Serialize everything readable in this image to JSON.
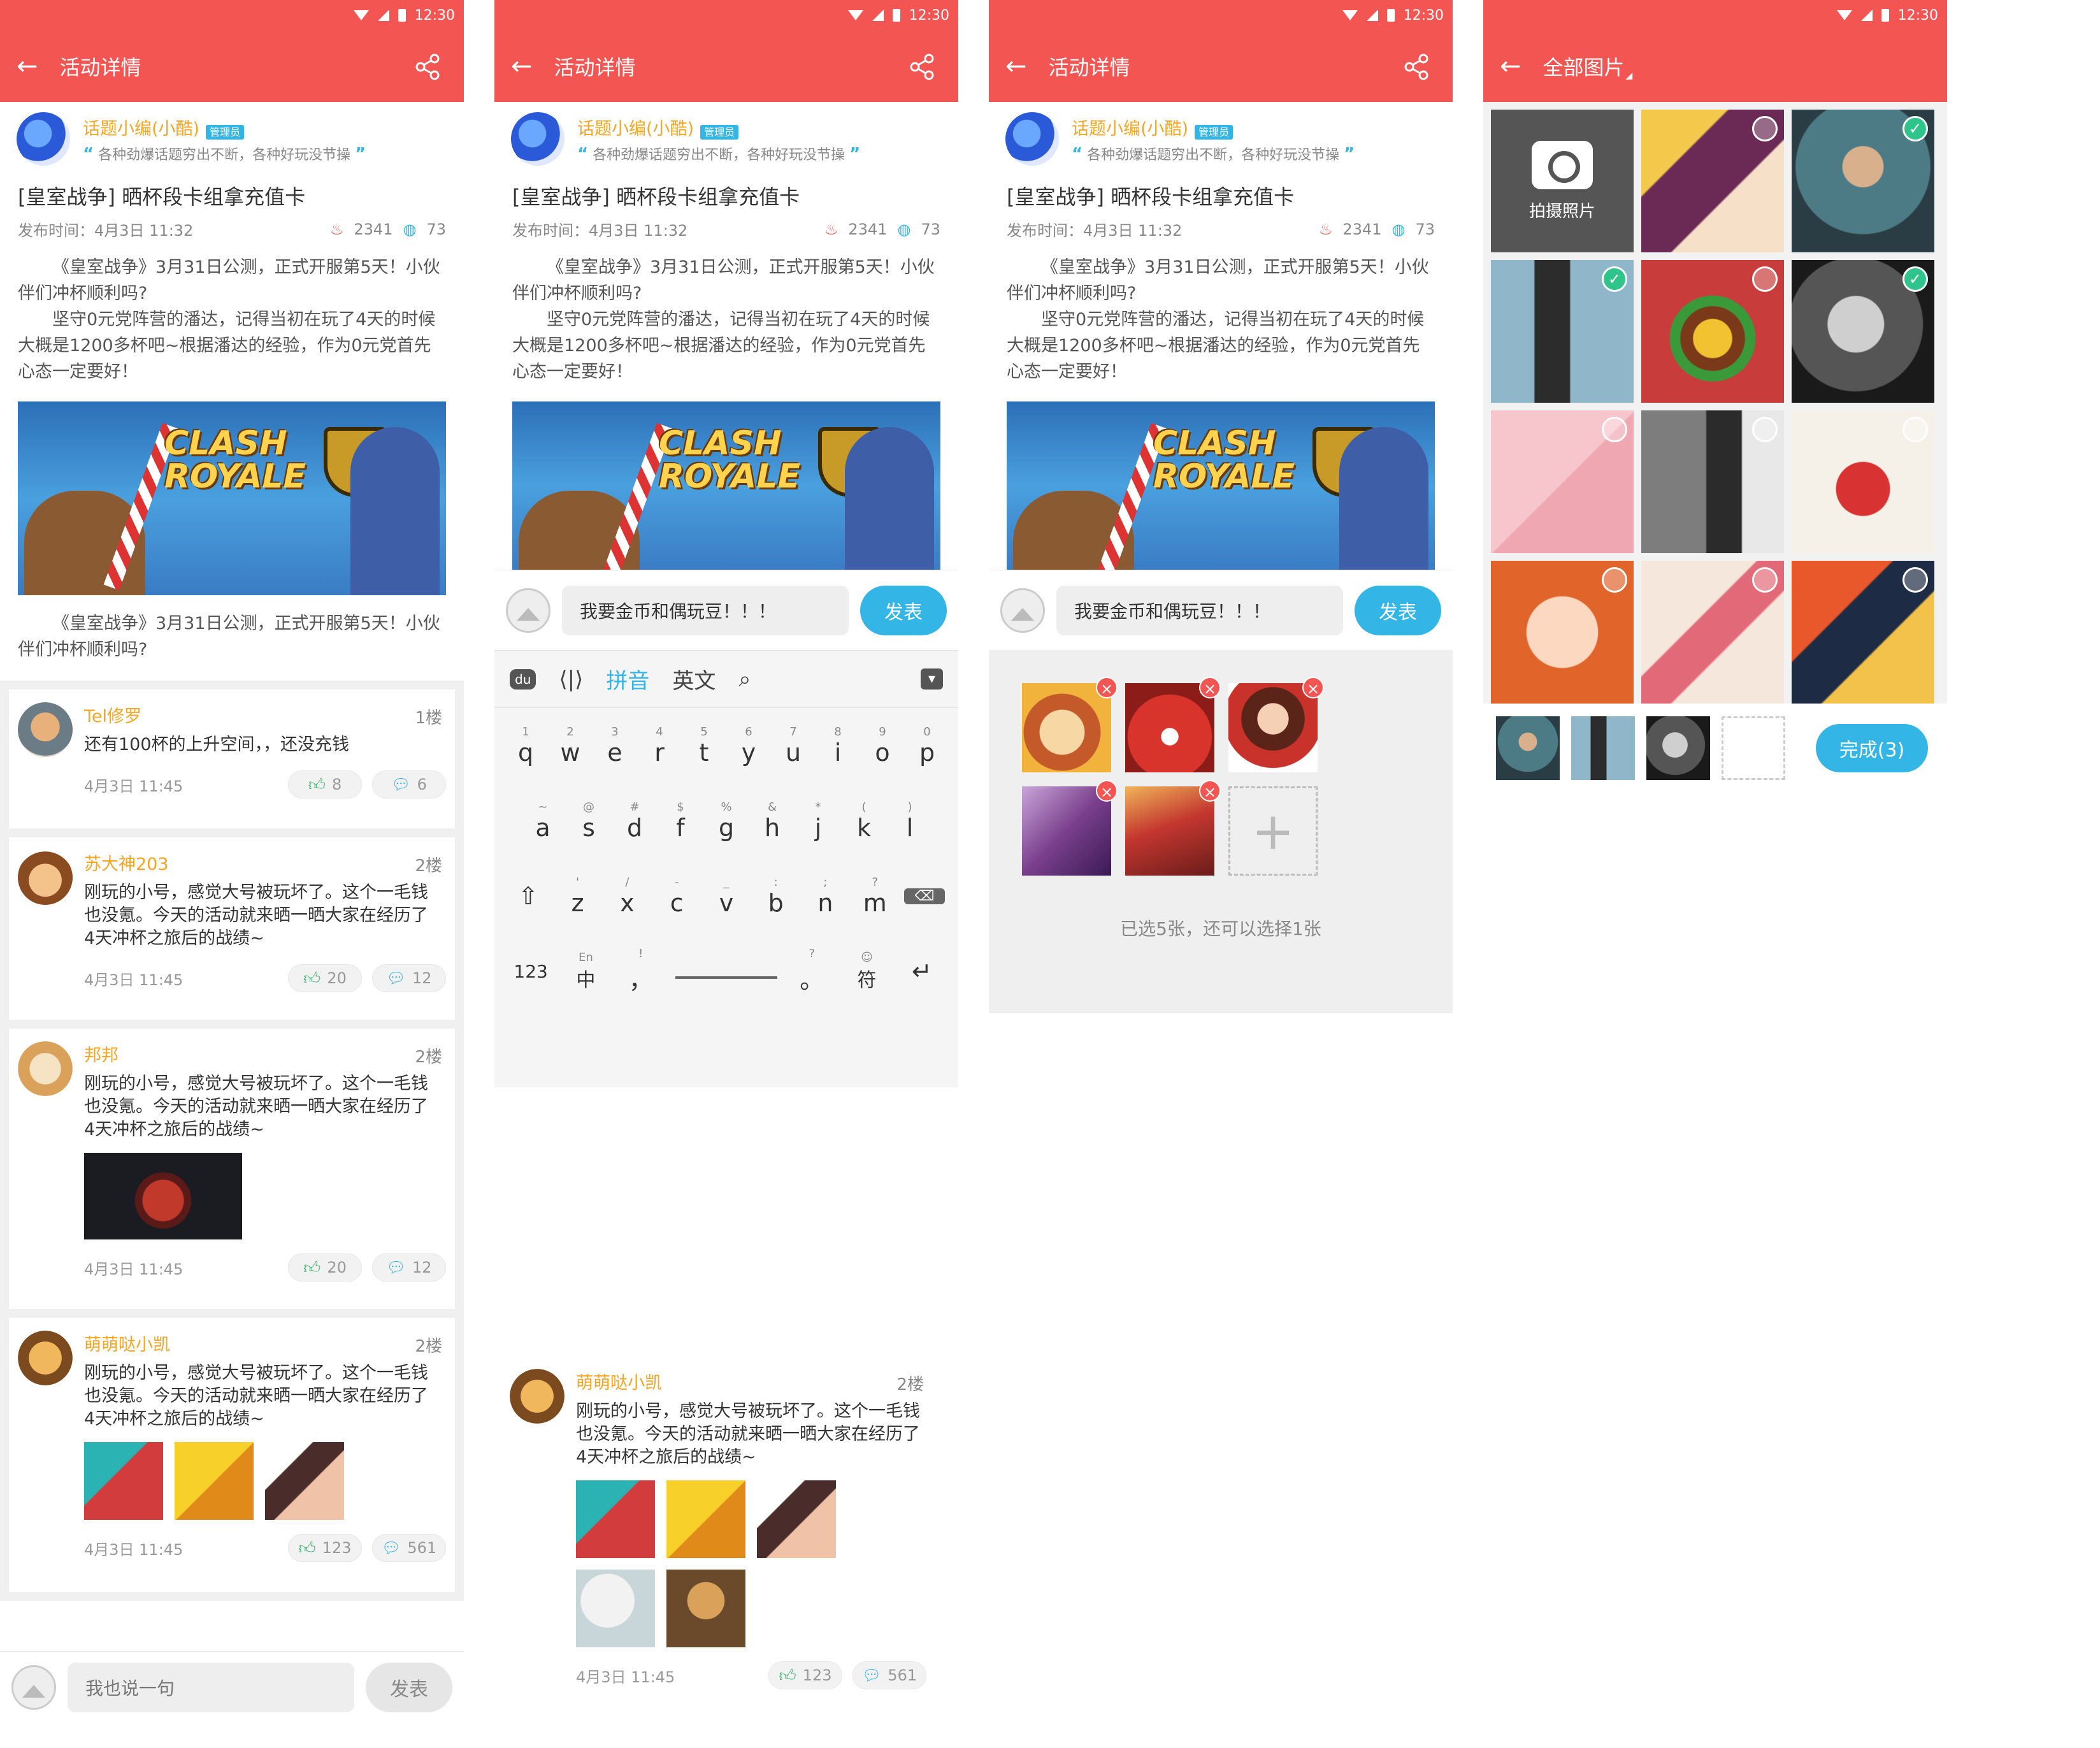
{
  "status": {
    "time": "12:30"
  },
  "screens": {
    "detail_title": "活动详情",
    "gallery_title": "全部图片"
  },
  "author": {
    "name": "话题小编(小酷)",
    "badge": "管理员",
    "motto": "各种劲爆话题穷出不断，各种好玩没节操"
  },
  "post": {
    "title": "[皇室战争] 晒杯段卡组拿充值卡",
    "published": "发布时间：4月3日 11:32",
    "heat": "2341",
    "comments": "73",
    "body_1": "《皇室战争》3月31日公测，正式开服第5天！小伙伴们冲杯顺利吗?",
    "body_2": "坚守0元党阵营的潘达，记得当初在玩了4天的时候大概是1200多杯吧~根据潘达的经验，作为0元党首先心态一定要好！",
    "banner_text": "CLASH ROYALE",
    "body_3": "《皇室战争》3月31日公测，正式开服第5天！小伙伴们冲杯顺利吗?"
  },
  "comments": [
    {
      "name": "Tel修罗",
      "floor": "1楼",
      "text": "还有100杯的上升空间，，还没充钱",
      "time": "4月3日 11:45",
      "likes": "8",
      "replies": "6"
    },
    {
      "name": "苏大神203",
      "floor": "2楼",
      "text": "刚玩的小号，感觉大号被玩坏了。这个一毛钱也没氪。今天的活动就来晒一晒大家在经历了4天冲杯之旅后的战绩~",
      "time": "4月3日 11:45",
      "likes": "20",
      "replies": "12"
    },
    {
      "name": "邦邦",
      "floor": "2楼",
      "text": "刚玩的小号，感觉大号被玩坏了。这个一毛钱也没氪。今天的活动就来晒一晒大家在经历了4天冲杯之旅后的战绩~",
      "time": "4月3日 11:45",
      "likes": "20",
      "replies": "12"
    },
    {
      "name": "萌萌哒小凯",
      "floor": "2楼",
      "text": "刚玩的小号，感觉大号被玩坏了。这个一毛钱也没氪。今天的活动就来晒一晒大家在经历了4天冲杯之旅后的战绩~",
      "time": "4月3日 11:45",
      "likes": "123",
      "replies": "561"
    }
  ],
  "input": {
    "placeholder": "我也说一句",
    "send": "发表",
    "typed": "我要金币和偶玩豆！！！"
  },
  "keyboard": {
    "toolbar": [
      "du",
      "拼音",
      "英文"
    ],
    "row1": [
      [
        "1",
        "q"
      ],
      [
        "2",
        "w"
      ],
      [
        "3",
        "e"
      ],
      [
        "4",
        "r"
      ],
      [
        "5",
        "t"
      ],
      [
        "6",
        "y"
      ],
      [
        "7",
        "u"
      ],
      [
        "8",
        "i"
      ],
      [
        "9",
        "o"
      ],
      [
        "0",
        "p"
      ]
    ],
    "row2": [
      [
        "~",
        "a"
      ],
      [
        "@",
        "s"
      ],
      [
        "#",
        "d"
      ],
      [
        "$",
        "f"
      ],
      [
        "%",
        "g"
      ],
      [
        "&",
        "h"
      ],
      [
        "*",
        "j"
      ],
      [
        "(",
        "k"
      ],
      [
        ")",
        "l"
      ]
    ],
    "row3": [
      [
        "'",
        "z"
      ],
      [
        "/",
        "x"
      ],
      [
        "-",
        "c"
      ],
      [
        "_",
        "v"
      ],
      [
        ":",
        "b"
      ],
      [
        ";",
        "n"
      ],
      [
        "?",
        "m"
      ]
    ],
    "num_key": "123",
    "lang_key_sub": "En",
    "lang_key": "中",
    "sym_key": "符"
  },
  "picker": {
    "hint": "已选5张，还可以选择1张"
  },
  "gallery": {
    "camera_label": "拍摄照片",
    "done": "完成(3)"
  },
  "colors": {
    "brand_red": "#f25552",
    "accent_blue": "#33b5e5",
    "name_orange": "#f6a623",
    "check_green": "#2ec48c"
  }
}
